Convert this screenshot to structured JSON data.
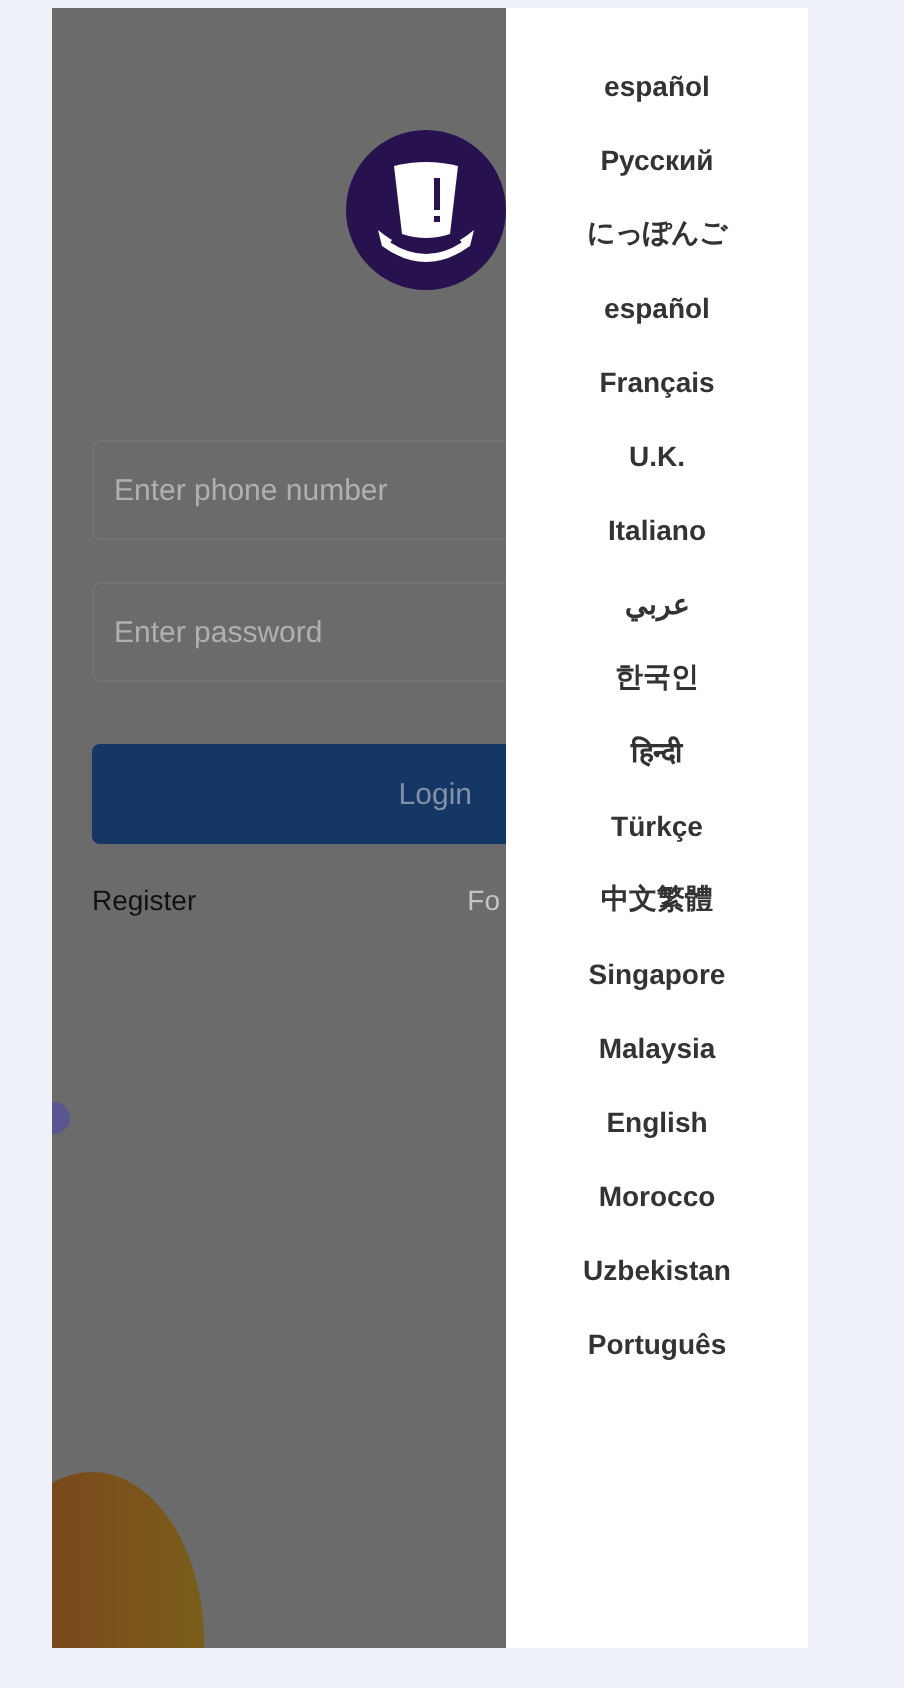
{
  "login": {
    "phone": {
      "placeholder": "Enter phone number"
    },
    "password": {
      "placeholder": "Enter password"
    },
    "button": "Login",
    "links": [
      "Register",
      "Fo"
    ]
  },
  "languages": [
    {
      "label": "español"
    },
    {
      "label": "Русский"
    },
    {
      "label": "にっぽんご"
    },
    {
      "label": "español"
    },
    {
      "label": "Français"
    },
    {
      "label": "U.K."
    },
    {
      "label": "Italiano"
    },
    {
      "label": "عربي"
    },
    {
      "label": "한국인"
    },
    {
      "label": "हिन्दी"
    },
    {
      "label": "Türkçe"
    },
    {
      "label": "中文繁體"
    },
    {
      "label": "Singapore"
    },
    {
      "label": "Malaysia"
    },
    {
      "label": "English"
    },
    {
      "label": "Morocco"
    },
    {
      "label": "Uzbekistan"
    },
    {
      "label": "Português"
    }
  ]
}
